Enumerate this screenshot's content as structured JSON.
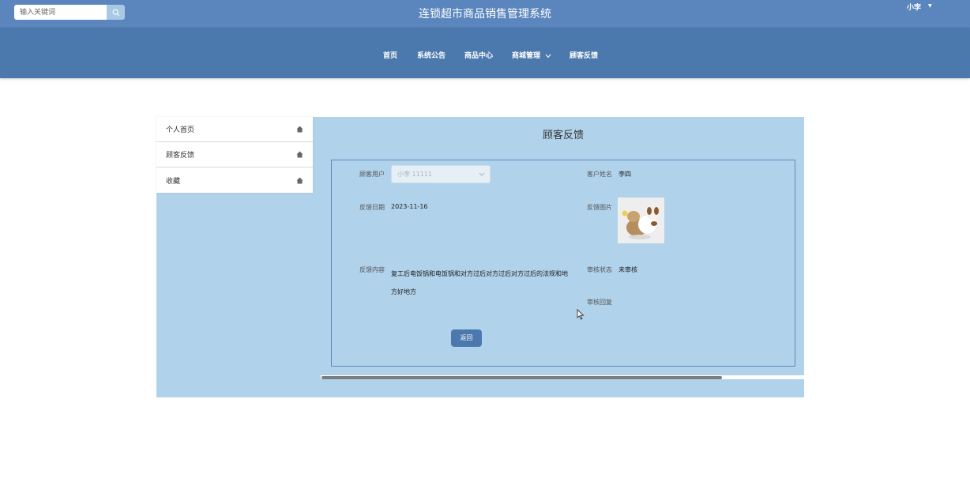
{
  "header": {
    "title": "连锁超市商品销售管理系统",
    "search_placeholder": "输入关键词",
    "user_name": "小李",
    "user_caret": "▼"
  },
  "nav": {
    "items": [
      {
        "label": "首页"
      },
      {
        "label": "系统公告"
      },
      {
        "label": "商品中心"
      },
      {
        "label": "商城管理"
      },
      {
        "label": "顾客反馈"
      }
    ]
  },
  "sidebar": {
    "items": [
      {
        "label": "个人首页"
      },
      {
        "label": "顾客反馈"
      },
      {
        "label": "收藏"
      }
    ]
  },
  "form": {
    "title": "顾客反馈",
    "fields": {
      "user_label": "顾客用户",
      "user_value": "小李 11111",
      "name_label": "客户姓名",
      "name_value": "李四",
      "date_label": "反馈日期",
      "date_value": "2023-11-16",
      "pic_label": "反馈图片",
      "content_label": "反馈内容",
      "content_value": "复工后电饭锅和电饭锅和对方过后对方过后对方过后的法规和地方好地方",
      "status_label": "审核状态",
      "status_value": "未审核",
      "reply_label": "审核回复",
      "reply_value": ""
    },
    "back_label": "返回"
  },
  "icons": {
    "search": "search-icon",
    "chevron": "chevron-down-icon",
    "home": "home-icon"
  },
  "colors": {
    "topbar": "#5b86bd",
    "navbar": "#4c79ad",
    "panel": "#b0d2ea",
    "accent": "#4c79ad"
  }
}
